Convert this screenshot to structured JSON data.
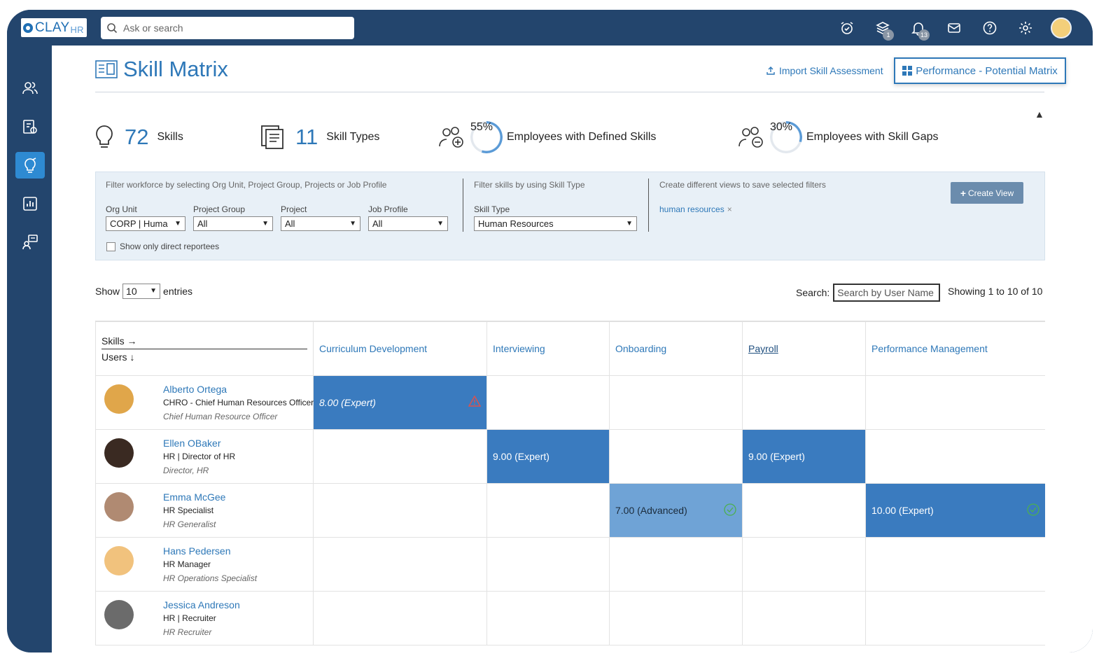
{
  "app": {
    "logo_text": "CLAY",
    "logo_sub": "HR"
  },
  "header": {
    "search_placeholder": "Ask or search",
    "badges": {
      "layers": "1",
      "notifications": "13"
    },
    "icons": [
      "alarm-clock-icon",
      "layers-icon",
      "bell-icon",
      "mail-icon",
      "help-icon",
      "gear-icon",
      "avatar"
    ]
  },
  "sidebar": {
    "items": [
      {
        "name": "people-icon",
        "active": false
      },
      {
        "name": "compensation-icon",
        "active": false
      },
      {
        "name": "skills-bulb-icon",
        "active": true
      },
      {
        "name": "reports-chart-icon",
        "active": false
      },
      {
        "name": "org-chart-icon",
        "active": false
      }
    ]
  },
  "page": {
    "title": "Skill Matrix",
    "import_label": "Import Skill Assessment",
    "perf_label": "Performance - Potential Matrix"
  },
  "stats": {
    "skills_count": "72",
    "skills_label": "Skills",
    "types_count": "11",
    "types_label": "Skill Types",
    "defined_pct": "55%",
    "defined_pct_value": 0.55,
    "defined_label": "Employees with Defined Skills",
    "gaps_pct": "30%",
    "gaps_pct_value": 0.3,
    "gaps_label": "Employees with Skill Gaps"
  },
  "filters": {
    "hint_workforce": "Filter workforce by selecting Org Unit, Project Group, Projects or Job Profile",
    "hint_skills": "Filter skills by using Skill Type",
    "hint_views": "Create different views to save selected filters",
    "org_unit_label": "Org Unit",
    "org_unit_value": "CORP | Huma",
    "project_group_label": "Project Group",
    "project_group_value": "All",
    "project_label": "Project",
    "project_value": "All",
    "job_profile_label": "Job Profile",
    "job_profile_value": "All",
    "skill_type_label": "Skill Type",
    "skill_type_value": "Human Resources",
    "direct_reportees_label": "Show only direct reportees",
    "saved_view": "human resources",
    "create_view_label": "Create View"
  },
  "table_controls": {
    "show_label": "Show",
    "entries_value": "10",
    "entries_label": "entries",
    "search_label": "Search:",
    "search_placeholder": "Search by User Name",
    "showing_text": "Showing 1 to 10 of 10"
  },
  "matrix": {
    "corner_skills": "Skills →",
    "corner_users": "Users ↓",
    "skills": [
      "Curriculum Development",
      "Interviewing",
      "Onboarding",
      "Payroll",
      "Performance Management"
    ],
    "users": [
      {
        "name": "Alberto Ortega",
        "job": "CHRO - Chief Human Resources Officer",
        "title": "Chief Human Resource Officer",
        "avatar_color": "#e0a64a",
        "cells": [
          "8.00 (Expert)",
          "",
          "",
          "",
          ""
        ]
      },
      {
        "name": "Ellen OBaker",
        "job": "HR | Director of HR",
        "title": "Director, HR",
        "avatar_color": "#3a2a22",
        "cells": [
          "",
          "9.00 (Expert)",
          "",
          "9.00 (Expert)",
          ""
        ]
      },
      {
        "name": "Emma McGee",
        "job": "HR Specialist",
        "title": "HR Generalist",
        "avatar_color": "#b08a72",
        "cells": [
          "",
          "",
          "7.00 (Advanced)",
          "",
          "10.00 (Expert)"
        ]
      },
      {
        "name": "Hans Pedersen",
        "job": "HR Manager",
        "title": "HR Operations Specialist",
        "avatar_color": "#f1c27d",
        "cells": [
          "",
          "",
          "",
          "",
          ""
        ]
      },
      {
        "name": "Jessica Andreson",
        "job": "HR | Recruiter",
        "title": "HR Recruiter",
        "avatar_color": "#6b6b6b",
        "cells": [
          "",
          "",
          "",
          "",
          ""
        ]
      }
    ]
  },
  "colors": {
    "navy": "#23456d",
    "accent": "#2e78b8",
    "expert": "#3a7bbf",
    "advanced": "#6fa3d6",
    "warning": "#d9534f",
    "ok": "#4caf50"
  }
}
